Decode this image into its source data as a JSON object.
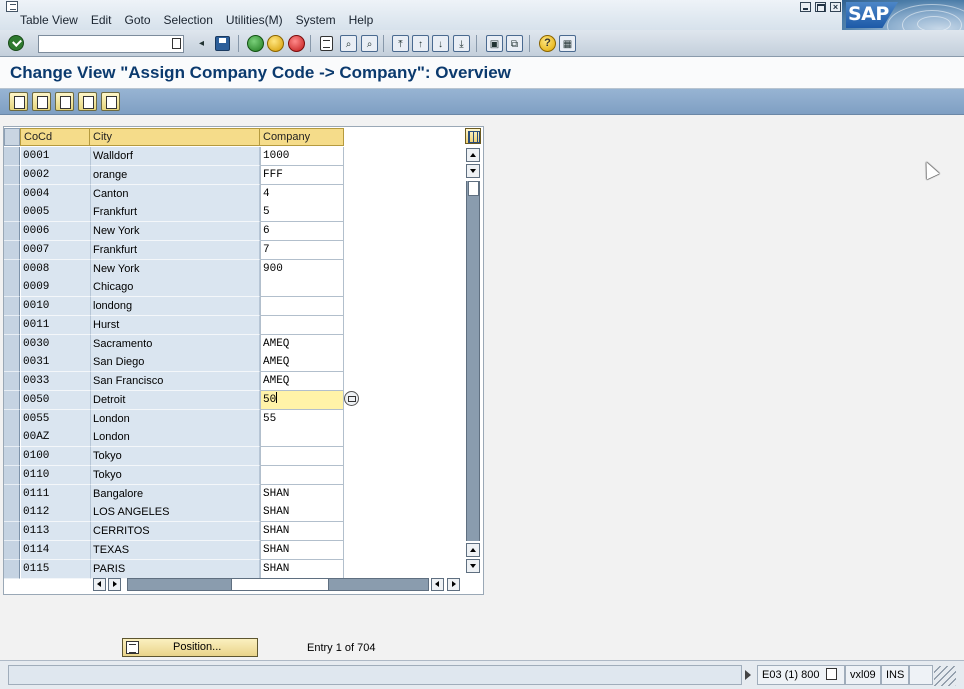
{
  "menu": {
    "items": [
      "Table View",
      "Edit",
      "Goto",
      "Selection",
      "Utilities(M)",
      "System",
      "Help"
    ]
  },
  "logo": {
    "text": "SAP"
  },
  "toolbar": {
    "command_field_value": ""
  },
  "title": "Change View \"Assign Company Code -> Company\": Overview",
  "table": {
    "headers": {
      "cocd": "CoCd",
      "city": "City",
      "company": "Company"
    },
    "rows": [
      {
        "cocd": "0001",
        "city": "Walldorf",
        "company": "1000"
      },
      {
        "cocd": "0002",
        "city": "orange",
        "company": "FFF"
      },
      {
        "cocd": "0004",
        "city": "Canton",
        "company": "4"
      },
      {
        "cocd": "0005",
        "city": "Frankfurt",
        "company": "5"
      },
      {
        "cocd": "0006",
        "city": "New York",
        "company": "6"
      },
      {
        "cocd": "0007",
        "city": "Frankfurt",
        "company": "7"
      },
      {
        "cocd": "0008",
        "city": "New York",
        "company": "900"
      },
      {
        "cocd": "0009",
        "city": "Chicago",
        "company": ""
      },
      {
        "cocd": "0010",
        "city": "londong",
        "company": ""
      },
      {
        "cocd": "0011",
        "city": "Hurst",
        "company": ""
      },
      {
        "cocd": "0030",
        "city": "Sacramento",
        "company": "AMEQ"
      },
      {
        "cocd": "0031",
        "city": "San Diego",
        "company": "AMEQ"
      },
      {
        "cocd": "0033",
        "city": "San Francisco",
        "company": "AMEQ"
      },
      {
        "cocd": "0050",
        "city": "Detroit",
        "company": "50"
      },
      {
        "cocd": "0055",
        "city": "London",
        "company": "55"
      },
      {
        "cocd": "00AZ",
        "city": "London",
        "company": ""
      },
      {
        "cocd": "0100",
        "city": "Tokyo",
        "company": ""
      },
      {
        "cocd": "0110",
        "city": "Tokyo",
        "company": ""
      },
      {
        "cocd": "0111",
        "city": "Bangalore",
        "company": "SHAN"
      },
      {
        "cocd": "0112",
        "city": "LOS ANGELES",
        "company": "SHAN"
      },
      {
        "cocd": "0113",
        "city": "CERRITOS",
        "company": "SHAN"
      },
      {
        "cocd": "0114",
        "city": "TEXAS",
        "company": "SHAN"
      },
      {
        "cocd": "0115",
        "city": "PARIS",
        "company": "SHAN"
      }
    ],
    "active_row_index": 13
  },
  "position_button": {
    "label": "Position..."
  },
  "entry_info": "Entry 1 of 704",
  "statusbar": {
    "message": "",
    "system": "E03 (1) 800",
    "host": "vxl09",
    "mode": "INS"
  }
}
